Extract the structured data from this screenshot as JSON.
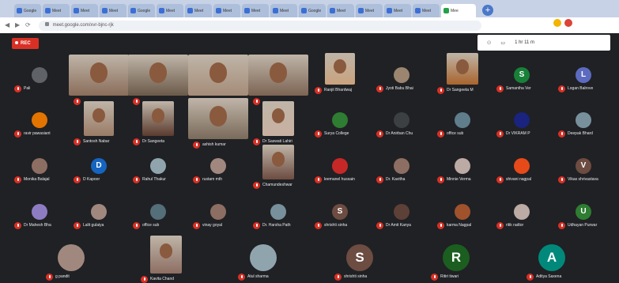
{
  "browser": {
    "tabs": [
      "Google",
      "Meet",
      "Meet",
      "Meet",
      "Google",
      "Meet",
      "Meet",
      "Meet",
      "Meet",
      "Meet",
      "Google",
      "Meet",
      "Meet",
      "Meet",
      "Meet",
      "Mee"
    ],
    "active_tab_index": 15,
    "url": "meet.google.com/xvr-bjnc-rjk",
    "toolbar_text": "1 hr 11 m"
  },
  "meeting": {
    "rec_label": "REC",
    "colors": {
      "background": "#202124",
      "rec": "#d93025",
      "mic_off": "#d93025"
    },
    "participants": [
      {
        "name": "Pali",
        "letter": "",
        "color": "#5f6368"
      },
      {
        "name": "",
        "letter": "",
        "color": "#8a6d5a"
      },
      {
        "name": "",
        "letter": "",
        "color": "#6b5a4a"
      },
      {
        "name": "",
        "letter": "",
        "color": "#a58c78"
      },
      {
        "name": "",
        "letter": "",
        "color": "#7c6453"
      },
      {
        "name": "Ranjit Bhardwaj",
        "letter": "",
        "color": "#c9a27e"
      },
      {
        "name": "Jyoti Babu Bhai",
        "letter": "",
        "color": "#9b8570"
      },
      {
        "name": "Dr Sangeeta M",
        "letter": "",
        "color": "#a8642d"
      },
      {
        "name": "Samantha Ver",
        "letter": "S",
        "color": "#188038"
      },
      {
        "name": "Logan Balrove",
        "letter": "L",
        "color": "#5c6bc0"
      },
      {
        "name": "ravir pawasiant",
        "letter": "",
        "color": "#e37400"
      },
      {
        "name": "Santosh Nabar",
        "letter": "",
        "color": "#9a7b66"
      },
      {
        "name": "Dr Sangeeta",
        "letter": "",
        "color": "#5a3b2e"
      },
      {
        "name": "ashish kumar",
        "letter": "",
        "color": "#7a6a5a"
      },
      {
        "name": "Dr Saswati Lahiri",
        "letter": "",
        "color": "#c8b0a0"
      },
      {
        "name": "Surya College",
        "letter": "",
        "color": "#2e7d32"
      },
      {
        "name": "Dr Anirban Chu",
        "letter": "",
        "color": "#3c4043"
      },
      {
        "name": "office sub",
        "letter": "",
        "color": "#607d8b"
      },
      {
        "name": "Dr VIKRAM P",
        "letter": "",
        "color": "#1a237e"
      },
      {
        "name": "Deepak Bhard",
        "letter": "",
        "color": "#78909c"
      },
      {
        "name": "Monika Balajal",
        "letter": "",
        "color": "#8d6e63"
      },
      {
        "name": "D Kapoor",
        "letter": "D",
        "color": "#1565c0"
      },
      {
        "name": "Rahul Thakur",
        "letter": "",
        "color": "#90a4ae"
      },
      {
        "name": "rustam mth",
        "letter": "",
        "color": "#a1887f"
      },
      {
        "name": "Chamundeshwar",
        "letter": "",
        "color": "#6d4c41"
      },
      {
        "name": "leemanel hussain",
        "letter": "",
        "color": "#c62828"
      },
      {
        "name": "Dr. Kavitha",
        "letter": "",
        "color": "#8d6e63"
      },
      {
        "name": "Minnie Verma",
        "letter": "",
        "color": "#bcaaa4"
      },
      {
        "name": "shivani nagpal",
        "letter": "",
        "color": "#e64a19"
      },
      {
        "name": "Vikas shrivastava",
        "letter": "V",
        "color": "#6d4c41"
      },
      {
        "name": "Dr Mahesh Bha",
        "letter": "",
        "color": "#8e7cc3"
      },
      {
        "name": "Lalit gulaiya",
        "letter": "",
        "color": "#a1887f"
      },
      {
        "name": "office sub",
        "letter": "",
        "color": "#546e7a"
      },
      {
        "name": "vinay goyal",
        "letter": "",
        "color": "#8d6e63"
      },
      {
        "name": "Dr. Harsha Path",
        "letter": "",
        "color": "#78909c"
      },
      {
        "name": "shrishti sinha",
        "letter": "S",
        "color": "#6d4c41"
      },
      {
        "name": "Dr Amit Kanya",
        "letter": "",
        "color": "#5d4037"
      },
      {
        "name": "karma Nagpal",
        "letter": "",
        "color": "#a0522d"
      },
      {
        "name": "ritik radtor",
        "letter": "",
        "color": "#bcaaa4"
      },
      {
        "name": "Udhayan Purwar",
        "letter": "U",
        "color": "#2e7d32"
      },
      {
        "name": "g pandit",
        "letter": "",
        "color": "#a1887f"
      },
      {
        "name": "Kavita Chand",
        "letter": "",
        "color": "#8d6e63"
      },
      {
        "name": "Atul sharma",
        "letter": "",
        "color": "#90a4ae"
      },
      {
        "name": "shrishti sinha",
        "letter": "S",
        "color": "#6d4c41"
      },
      {
        "name": "Ritiri tiwari",
        "letter": "R",
        "color": "#1b5e20"
      },
      {
        "name": "Aditya Saxena",
        "letter": "A",
        "color": "#00897b"
      }
    ]
  }
}
